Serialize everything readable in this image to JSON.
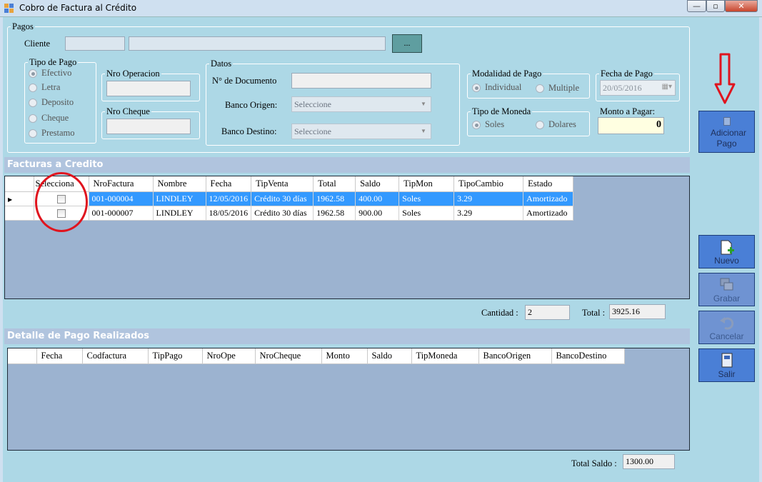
{
  "window": {
    "title": "Cobro de Factura al Crédito",
    "min": "0",
    "max": "1",
    "close": "r"
  },
  "pagos": {
    "legend": "Pagos",
    "cliente_label": "Cliente",
    "cliente_code": "",
    "cliente_name": "",
    "lookup_btn": "...",
    "tipo_pago": {
      "legend": "Tipo de Pago",
      "options": [
        "Efectivo",
        "Letra",
        "Deposito",
        "Cheque",
        "Prestamo"
      ],
      "selected": "Efectivo"
    },
    "nro_operacion": {
      "legend": "Nro Operacion",
      "value": ""
    },
    "nro_cheque": {
      "legend": "Nro Cheque",
      "value": ""
    },
    "datos": {
      "legend": "Datos",
      "nro_documento_label": "N° de Documento",
      "nro_documento_value": "",
      "banco_origen_label": "Banco Origen:",
      "banco_origen_value": "Seleccione",
      "banco_destino_label": "Banco Destino:",
      "banco_destino_value": "Seleccione"
    },
    "modalidad": {
      "legend": "Modalidad de Pago",
      "options": [
        "Individual",
        "Multiple"
      ],
      "selected": "Individual"
    },
    "fecha_pago": {
      "legend": "Fecha de Pago",
      "value": "20/05/2016"
    },
    "tipo_moneda": {
      "legend": "Tipo de Moneda",
      "options": [
        "Soles",
        "Dolares"
      ],
      "selected": "Soles"
    },
    "monto_label": "Monto a Pagar:",
    "monto_value": "0"
  },
  "facturas": {
    "title": "Facturas a Credito",
    "columns": [
      "Selecciona",
      "NroFactura",
      "Nombre",
      "Fecha",
      "TipVenta",
      "Total",
      "Saldo",
      "TipMon",
      "TipoCambio",
      "Estado"
    ],
    "rows": [
      [
        "",
        "001-000004",
        "LINDLEY",
        "12/05/2016",
        "Crédito 30 días",
        "1962.58",
        "400.00",
        "Soles",
        "3.29",
        "Amortizado"
      ],
      [
        "",
        "001-000007",
        "LINDLEY",
        "18/05/2016",
        "Crédito 30 días",
        "1962.58",
        "900.00",
        "Soles",
        "3.29",
        "Amortizado"
      ]
    ],
    "cantidad_label": "Cantidad :",
    "cantidad_value": "2",
    "total_label": "Total :",
    "total_value": "3925.16"
  },
  "detalle": {
    "title": "Detalle de Pago Realizados",
    "columns": [
      "Fecha",
      "Codfactura",
      "TipPago",
      "NroOpe",
      "NroCheque",
      "Monto",
      "Saldo",
      "TipMoneda",
      "BancoOrigen",
      "BancoDestino"
    ],
    "total_saldo_label": "Total Saldo :",
    "total_saldo_value": "1300.00"
  },
  "side": {
    "adicionar": "Adicionar Pago",
    "nuevo": "Nuevo",
    "grabar": "Grabar",
    "cancelar": "Cancelar",
    "salir": "Salir"
  },
  "colors": {
    "form_bg": "#add8e6",
    "accent_button": "#4a7fd6",
    "selection": "#3399ff",
    "annotation": "#e0141e"
  }
}
